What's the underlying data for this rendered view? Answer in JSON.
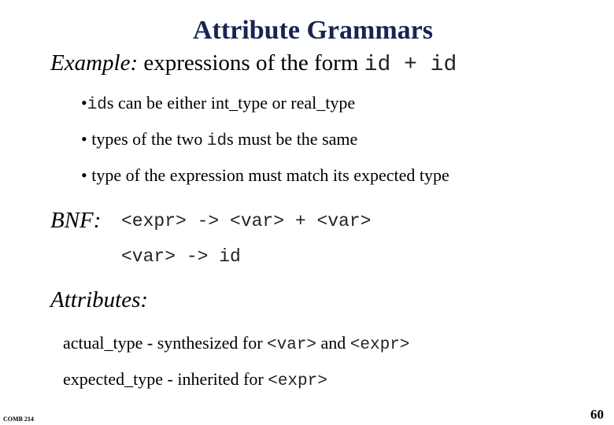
{
  "slide": {
    "title": "Attribute Grammars",
    "example": {
      "label": "Example:",
      "text": " expressions of the form ",
      "code": "id + id"
    },
    "bullets": [
      {
        "bullet": "•",
        "code": "id",
        "text": "s can be either int_type or real_type"
      },
      {
        "bullet": "•",
        "text_before": " types of the two ",
        "code": "id",
        "text": "s must be the same"
      },
      {
        "bullet": "•",
        "text": " type of the expression must match its expected type"
      }
    ],
    "bnf": {
      "label": "BNF:",
      "rules": [
        "<expr> -> <var> + <var>",
        "<var> -> id"
      ]
    },
    "attributes": {
      "label": "Attributes:",
      "items": [
        {
          "text": "actual_type - synthesized for ",
          "code1": "<var>",
          "mid": " and ",
          "code2": "<expr>"
        },
        {
          "text": "expected_type - inherited for ",
          "code1": "<expr>"
        }
      ]
    },
    "footer": {
      "course": "COMB 214",
      "page_number": "60"
    }
  }
}
